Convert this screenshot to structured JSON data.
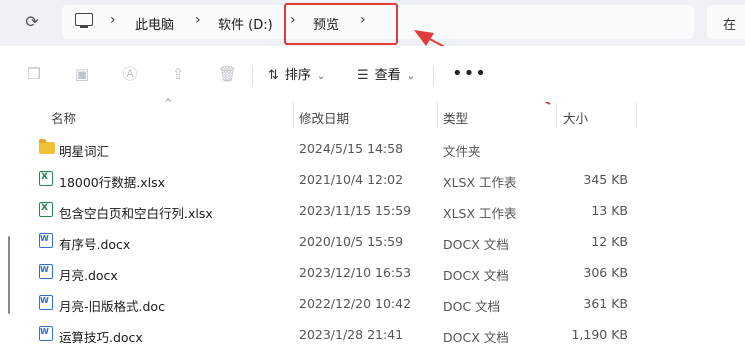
{
  "address_bar": {
    "crumbs": [
      "此电脑",
      "软件 (D:)",
      "预览"
    ],
    "search_placeholder": "在"
  },
  "toolbar": {
    "sort_label": "排序",
    "view_label": "查看",
    "more_label": "•••"
  },
  "columns": {
    "name": "名称",
    "date": "修改日期",
    "type": "类型",
    "size": "大小"
  },
  "files": [
    {
      "name": "明星词汇",
      "date": "2024/5/15 14:58",
      "type": "文件夹",
      "size": "",
      "icon": "folder-icon"
    },
    {
      "name": "18000行数据.xlsx",
      "date": "2021/10/4 12:02",
      "type": "XLSX 工作表",
      "size": "345 KB",
      "icon": "excel-file-icon"
    },
    {
      "name": "包含空白页和空白行列.xlsx",
      "date": "2023/11/15 15:59",
      "type": "XLSX 工作表",
      "size": "13 KB",
      "icon": "excel-file-icon"
    },
    {
      "name": "有序号.docx",
      "date": "2020/10/5 15:59",
      "type": "DOCX 文档",
      "size": "12 KB",
      "icon": "word-file-icon"
    },
    {
      "name": "月亮.docx",
      "date": "2023/12/10 16:53",
      "type": "DOCX 文档",
      "size": "306 KB",
      "icon": "word-file-icon"
    },
    {
      "name": "月亮-旧版格式.doc",
      "date": "2022/12/20 10:42",
      "type": "DOC 文档",
      "size": "361 KB",
      "icon": "word-file-icon"
    },
    {
      "name": "运算技巧.docx",
      "date": "2023/1/28 21:41",
      "type": "DOCX 文档",
      "size": "1,190 KB",
      "icon": "word-file-icon"
    }
  ],
  "colors": {
    "annotation_red": "#e23b3b",
    "folder_yellow": "#f2c038",
    "excel_green": "#1f8a4c",
    "word_blue": "#2f6fd0"
  }
}
